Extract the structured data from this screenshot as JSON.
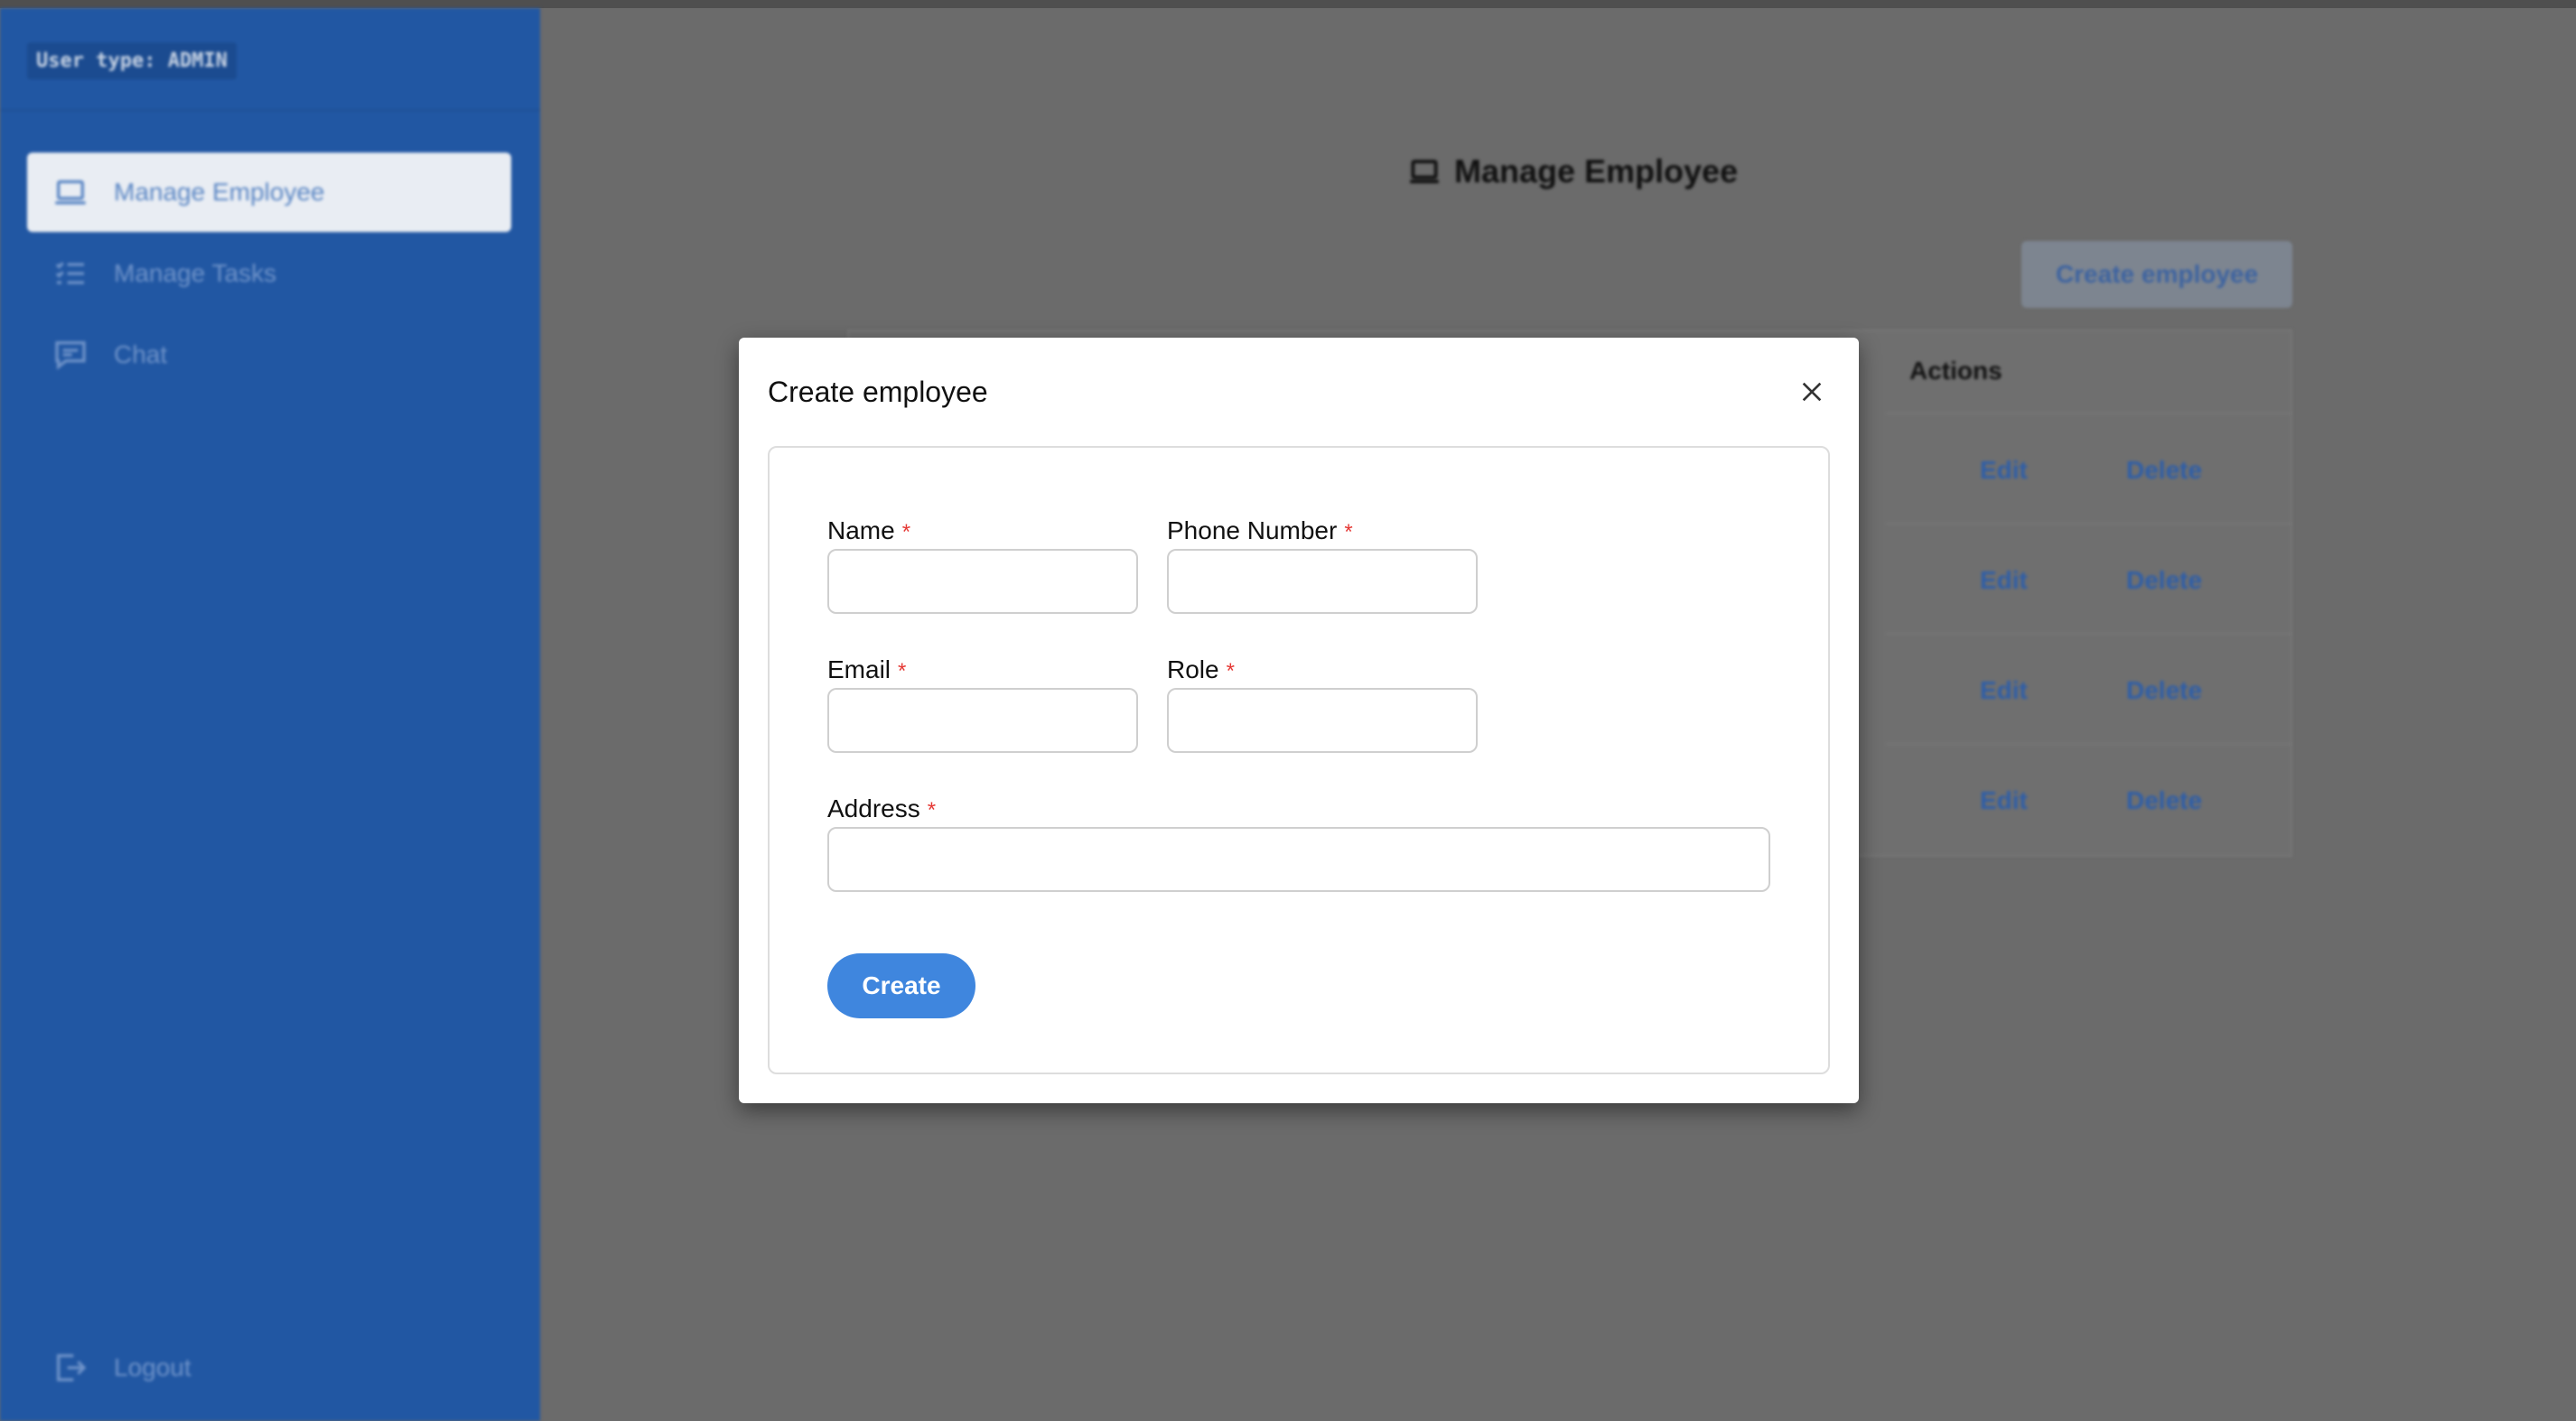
{
  "sidebar": {
    "user_type": "User type: ADMIN",
    "items": [
      {
        "label": "Manage Employee",
        "icon": "laptop-icon",
        "active": true
      },
      {
        "label": "Manage Tasks",
        "icon": "list-icon",
        "active": false
      },
      {
        "label": "Chat",
        "icon": "chat-icon",
        "active": false
      }
    ],
    "logout_label": "Logout"
  },
  "main": {
    "title": "Manage Employee",
    "create_button_label": "Create employee",
    "table": {
      "actions_header": "Actions",
      "rows": [
        {
          "edit": "Edit",
          "delete": "Delete"
        },
        {
          "edit": "Edit",
          "delete": "Delete"
        },
        {
          "edit": "Edit",
          "delete": "Delete"
        },
        {
          "edit": "Edit",
          "delete": "Delete"
        }
      ]
    }
  },
  "modal": {
    "title": "Create employee",
    "fields": {
      "name": {
        "label": "Name",
        "value": ""
      },
      "phone": {
        "label": "Phone Number",
        "value": ""
      },
      "email": {
        "label": "Email",
        "value": ""
      },
      "role": {
        "label": "Role",
        "value": ""
      },
      "address": {
        "label": "Address",
        "value": ""
      }
    },
    "required_marker": "*",
    "submit_label": "Create"
  },
  "colors": {
    "sidebar_bg": "#2157a3",
    "primary_button": "#3f86de",
    "required": "#e53935"
  }
}
